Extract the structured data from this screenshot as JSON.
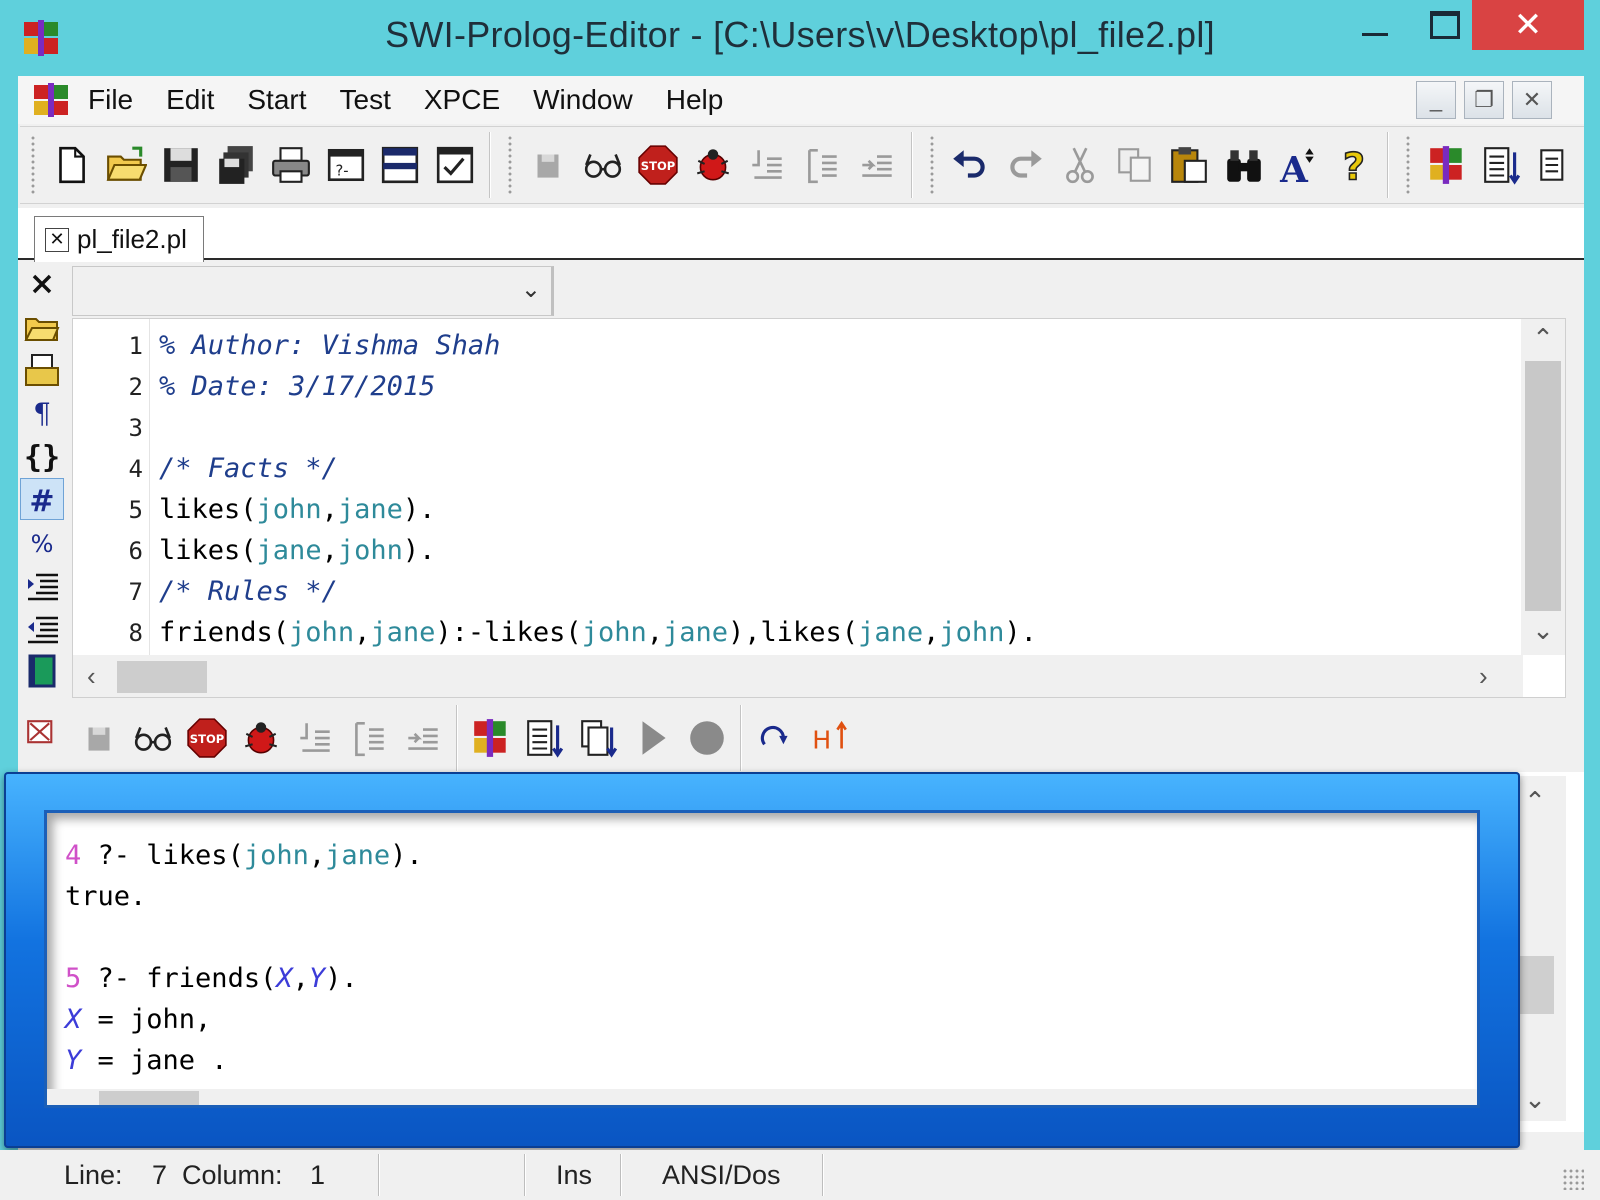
{
  "window": {
    "title": "SWI-Prolog-Editor - [C:\\Users\\v\\Desktop\\pl_file2.pl]",
    "close_glyph": "✕"
  },
  "menu": [
    "File",
    "Edit",
    "Start",
    "Test",
    "XPCE",
    "Window",
    "Help"
  ],
  "mdi": {
    "minimize": "_",
    "restore": "❐",
    "close": "✕"
  },
  "tab": {
    "label": "pl_file2.pl",
    "close_glyph": "✕"
  },
  "editor": {
    "lines": [
      {
        "num": "1",
        "parts": [
          {
            "t": "% Author: Vishma Shah",
            "c": "cmt"
          }
        ]
      },
      {
        "num": "2",
        "parts": [
          {
            "t": "% Date: 3/17/2015",
            "c": "cmt"
          }
        ]
      },
      {
        "num": "3",
        "parts": []
      },
      {
        "num": "4",
        "parts": [
          {
            "t": "/* Facts */",
            "c": "cmt"
          }
        ]
      },
      {
        "num": "5",
        "parts": [
          {
            "t": "likes(",
            "c": ""
          },
          {
            "t": "john",
            "c": "atom"
          },
          {
            "t": ",",
            "c": ""
          },
          {
            "t": "jane",
            "c": "atom"
          },
          {
            "t": ").",
            "c": ""
          }
        ]
      },
      {
        "num": "6",
        "parts": [
          {
            "t": "likes(",
            "c": ""
          },
          {
            "t": "jane",
            "c": "atom"
          },
          {
            "t": ",",
            "c": ""
          },
          {
            "t": "john",
            "c": "atom"
          },
          {
            "t": ").",
            "c": ""
          }
        ]
      },
      {
        "num": "7",
        "parts": [
          {
            "t": "/* Rules */",
            "c": "cmt"
          }
        ]
      },
      {
        "num": "8",
        "parts": [
          {
            "t": "friends(",
            "c": ""
          },
          {
            "t": "john",
            "c": "atom"
          },
          {
            "t": ",",
            "c": ""
          },
          {
            "t": "jane",
            "c": "atom"
          },
          {
            "t": "):-likes(",
            "c": ""
          },
          {
            "t": "john",
            "c": "atom"
          },
          {
            "t": ",",
            "c": ""
          },
          {
            "t": "jane",
            "c": "atom"
          },
          {
            "t": "),likes(",
            "c": ""
          },
          {
            "t": "jane",
            "c": "atom"
          },
          {
            "t": ",",
            "c": ""
          },
          {
            "t": "john",
            "c": "atom"
          },
          {
            "t": ").",
            "c": ""
          }
        ]
      }
    ]
  },
  "console": {
    "lines": [
      {
        "parts": [
          {
            "t": "4",
            "c": "qnum"
          },
          {
            "t": " ?- likes(",
            "c": ""
          },
          {
            "t": "john",
            "c": "atom"
          },
          {
            "t": ",",
            "c": ""
          },
          {
            "t": "jane",
            "c": "atom"
          },
          {
            "t": ").",
            "c": ""
          }
        ]
      },
      {
        "parts": [
          {
            "t": "true.",
            "c": ""
          }
        ]
      },
      {
        "parts": []
      },
      {
        "parts": [
          {
            "t": "5",
            "c": "qnum"
          },
          {
            "t": " ?- friends(",
            "c": ""
          },
          {
            "t": "X",
            "c": "var"
          },
          {
            "t": ",",
            "c": ""
          },
          {
            "t": "Y",
            "c": "var"
          },
          {
            "t": ").",
            "c": ""
          }
        ]
      },
      {
        "parts": [
          {
            "t": "X",
            "c": "var"
          },
          {
            "t": " = john,",
            "c": ""
          }
        ]
      },
      {
        "parts": [
          {
            "t": "Y",
            "c": "var"
          },
          {
            "t": " = jane .",
            "c": ""
          }
        ]
      }
    ]
  },
  "statusbar": {
    "line_label": "Line:",
    "line_value": "7",
    "column_label": "Column:",
    "column_value": "1",
    "mode": "Ins",
    "encoding": "ANSI/Dos"
  },
  "colors": {
    "comment": "#1f3e8c",
    "atom": "#2e8a9a",
    "variable": "#3c3cd8",
    "query_number": "#d050c8",
    "frame": "#1273e0",
    "title_bar": "#5fd0dc"
  }
}
